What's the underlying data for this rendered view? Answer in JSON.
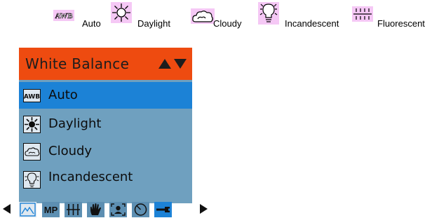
{
  "legend": [
    {
      "icon": "awb-icon",
      "label": "Auto"
    },
    {
      "icon": "sun-icon",
      "label": "Daylight"
    },
    {
      "icon": "cloud-icon",
      "label": "Cloudy"
    },
    {
      "icon": "bulb-icon",
      "label": "Incandescent"
    },
    {
      "icon": "fluorescent-icon",
      "label": "Fluorescent"
    }
  ],
  "menu": {
    "title": "White Balance",
    "items": [
      {
        "icon": "awb-icon",
        "label": "Auto",
        "selected": true
      },
      {
        "icon": "sun-icon",
        "label": "Daylight",
        "selected": false
      },
      {
        "icon": "cloud-icon",
        "label": "Cloudy",
        "selected": false
      },
      {
        "icon": "bulb-icon",
        "label": "Incandescent",
        "selected": false
      }
    ]
  },
  "tabs": [
    {
      "icon": "image-quality-icon",
      "active": false
    },
    {
      "icon": "mp-icon",
      "text": "MP",
      "active": false
    },
    {
      "icon": "metering-icon",
      "active": false
    },
    {
      "icon": "hand-icon",
      "active": false
    },
    {
      "icon": "portrait-icon",
      "active": false
    },
    {
      "icon": "self-timer-icon",
      "active": false
    },
    {
      "icon": "wrench-icon",
      "active": true
    }
  ],
  "colors": {
    "header": "#ee4b10",
    "menu_bg": "#6fa0bf",
    "selected": "#1c82d6",
    "legend_icon_bg": "#f5c8f5"
  }
}
